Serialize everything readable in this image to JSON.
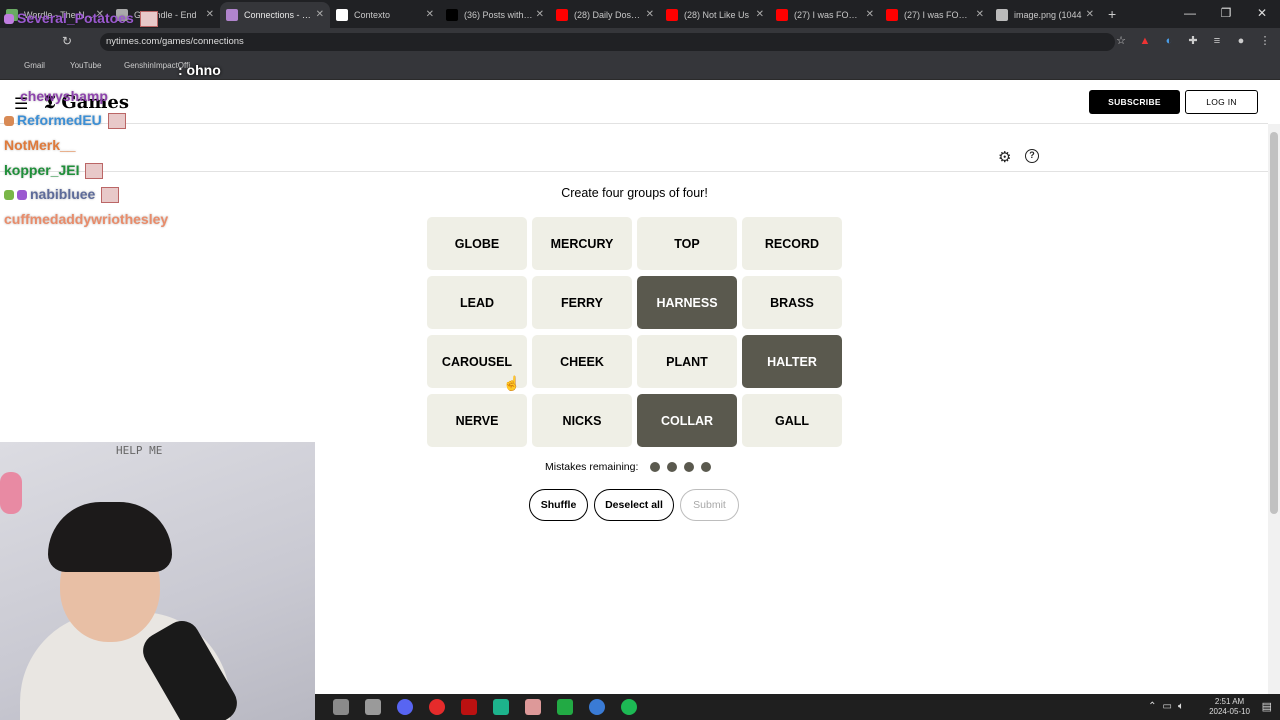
{
  "browser": {
    "tabs": [
      {
        "label": "Wordle - The New",
        "color": "#6aaa64",
        "active": false
      },
      {
        "label": "Gamindle - End",
        "color": "#aaaaaa",
        "active": false
      },
      {
        "label": "Connections - The",
        "color": "#b084cc",
        "active": true
      },
      {
        "label": "Contexto",
        "color": "#ffffff",
        "active": false
      },
      {
        "label": "(36) Posts with re",
        "color": "#000000",
        "active": false
      },
      {
        "label": "(28) Daily Dose of",
        "color": "#ff0000",
        "active": false
      },
      {
        "label": "(28) Not Like Us",
        "color": "#ff0000",
        "active": false
      },
      {
        "label": "(27) I was FORCED",
        "color": "#ff0000",
        "active": false
      },
      {
        "label": "(27) I was FORCE",
        "color": "#ff0000",
        "active": false
      },
      {
        "label": "image.png (1044",
        "color": "#bbbbbb",
        "active": false
      }
    ],
    "url": "nytimes.com/games/connections",
    "bookmarks": [
      "Gmail",
      "YouTube",
      "GenshinImpactOffi"
    ]
  },
  "header": {
    "logo": "Games",
    "subscribe_label": "SUBSCRIBE",
    "login_label": "LOG IN"
  },
  "game": {
    "instructions": "Create four groups of four!",
    "cards": [
      {
        "word": "GLOBE",
        "selected": false
      },
      {
        "word": "MERCURY",
        "selected": false
      },
      {
        "word": "TOP",
        "selected": false
      },
      {
        "word": "RECORD",
        "selected": false
      },
      {
        "word": "LEAD",
        "selected": false
      },
      {
        "word": "FERRY",
        "selected": false
      },
      {
        "word": "HARNESS",
        "selected": true
      },
      {
        "word": "BRASS",
        "selected": false
      },
      {
        "word": "CAROUSEL",
        "selected": false
      },
      {
        "word": "CHEEK",
        "selected": false
      },
      {
        "word": "PLANT",
        "selected": false
      },
      {
        "word": "HALTER",
        "selected": true
      },
      {
        "word": "NERVE",
        "selected": false
      },
      {
        "word": "NICKS",
        "selected": false
      },
      {
        "word": "COLLAR",
        "selected": true
      },
      {
        "word": "GALL",
        "selected": false
      }
    ],
    "mistakes_label": "Mistakes remaining:",
    "mistakes_remaining": 4,
    "shuffle_label": "Shuffle",
    "deselect_label": "Deselect all",
    "submit_label": "Submit"
  },
  "stream": {
    "chat": [
      {
        "user": "Several_Potatoes",
        "color": "#9b59d0"
      },
      {
        "user": ": ohno",
        "color": "#ffffff"
      },
      {
        "user": "chewyshamp",
        "color": "#8e44ad"
      },
      {
        "user": "ReformedEU",
        "color": "#3b8fd6"
      },
      {
        "user": "NotMerk__",
        "color": "#e07a3a"
      },
      {
        "user": "kopper_JEI",
        "color": "#1f8f3a"
      },
      {
        "user": "nabibluee",
        "color": "#5d6b9a"
      },
      {
        "user": "cuffmedaddywriothesley",
        "color": "#e98c6a"
      }
    ],
    "board_text": "HELP ME"
  },
  "taskbar": {
    "time": "2:51 AM",
    "date": "2024-05-10"
  }
}
